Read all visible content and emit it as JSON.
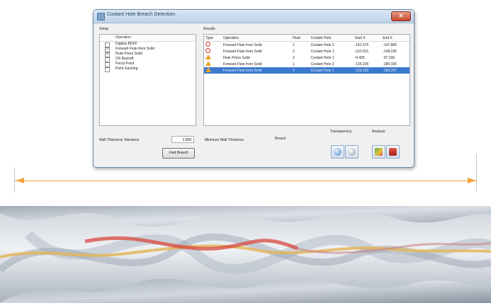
{
  "window": {
    "title": "Coolant Hole Breach Detection",
    "close_label": "✕"
  },
  "setup": {
    "group_label": "Setup",
    "column_header": "Operation",
    "operations": [
      {
        "label": "Digitize BDFF",
        "checked": false
      },
      {
        "label": "Forward Flute from Solid",
        "checked": true
      },
      {
        "label": "Flute Press Solid",
        "checked": true
      },
      {
        "label": "OS Backoff",
        "checked": false
      },
      {
        "label": "Pencil Point",
        "checked": false
      },
      {
        "label": "Point Gashing",
        "checked": false
      }
    ]
  },
  "results": {
    "group_label": "Results",
    "columns": [
      "Type",
      "Operation",
      "Flute",
      "Coolant Hole",
      "Start X",
      "End X"
    ],
    "rows": [
      {
        "type": "error-icon",
        "operation": "Forward Flute from Solid",
        "flute": "1",
        "hole": "Coolant Hole 2",
        "start_x": "-141.575",
        "end_x": "-147.866",
        "selected": false
      },
      {
        "type": "error-icon",
        "operation": "Forward Flute from Solid",
        "flute": "2",
        "hole": "Coolant Hole 1",
        "start_x": "-110.015",
        "end_x": "-148.226",
        "selected": false
      },
      {
        "type": "warning-icon",
        "operation": "Flute Press Solid",
        "flute": "2",
        "hole": "Coolant Hole 1",
        "start_x": "-9.425",
        "end_x": "-97.336",
        "selected": false
      },
      {
        "type": "warning-icon",
        "operation": "Forward Flute from Solid",
        "flute": "1",
        "hole": "Coolant Hole 2",
        "start_x": "-135.235",
        "end_x": "-180.336",
        "selected": false
      },
      {
        "type": "warning-icon",
        "operation": "Forward Flute from Solid",
        "flute": "2",
        "hole": "Coolant Hole 1",
        "start_x": "-136.235",
        "end_x": "-180.347",
        "selected": true
      }
    ]
  },
  "controls": {
    "wall_tolerance_label": "Wall Thickness Tolerance",
    "wall_tolerance_value": "1.500",
    "find_button": "Find Breach",
    "min_wall_label": "Minimum Wall Thickness",
    "min_wall_value": "Breach",
    "transparency_label": "Transparency",
    "analysis_label": "Analysis"
  },
  "colors": {
    "accent": "#3b79cf",
    "error": "#d8321d",
    "warning": "#e9a12a",
    "dimension": "#f1a33b",
    "coolant_red": "#d9473c",
    "coolant_yellow": "#e2b65a"
  }
}
